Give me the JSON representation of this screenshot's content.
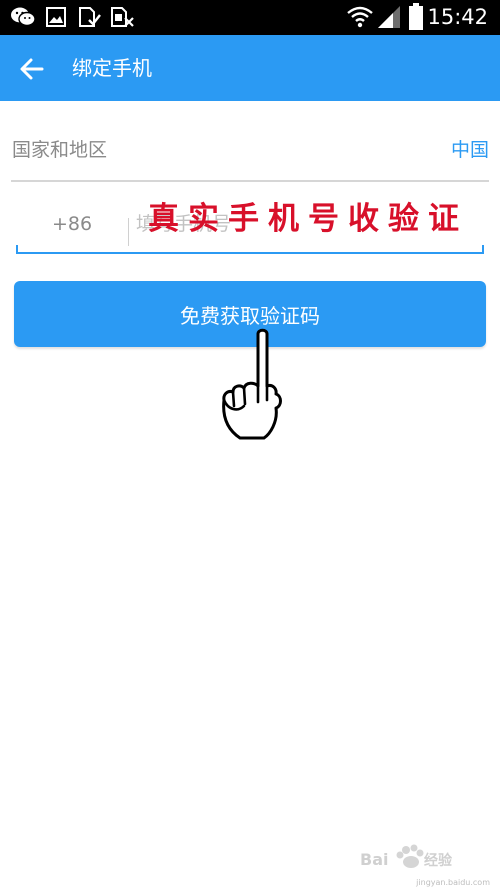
{
  "status_bar": {
    "time": "15:42",
    "icons": [
      "wechat-icon",
      "gallery-icon",
      "sim-card-icon",
      "blocked-sim-icon",
      "wifi-icon",
      "signal-icon",
      "battery-icon"
    ]
  },
  "app_bar": {
    "title": "绑定手机",
    "back_icon": "back-arrow-icon"
  },
  "form": {
    "region_label": "国家和地区",
    "region_value": "中国",
    "country_code": "+86",
    "phone_placeholder": "填写手机号",
    "phone_value": ""
  },
  "button": {
    "label": "免费获取验证码"
  },
  "annotation": {
    "text": "真实手机号收验证"
  },
  "watermark": {
    "url": "jingyan.baidu.com"
  },
  "colors": {
    "accent": "#2b9af3",
    "annotation_red": "#d8102a",
    "status_bar": "#000000"
  }
}
